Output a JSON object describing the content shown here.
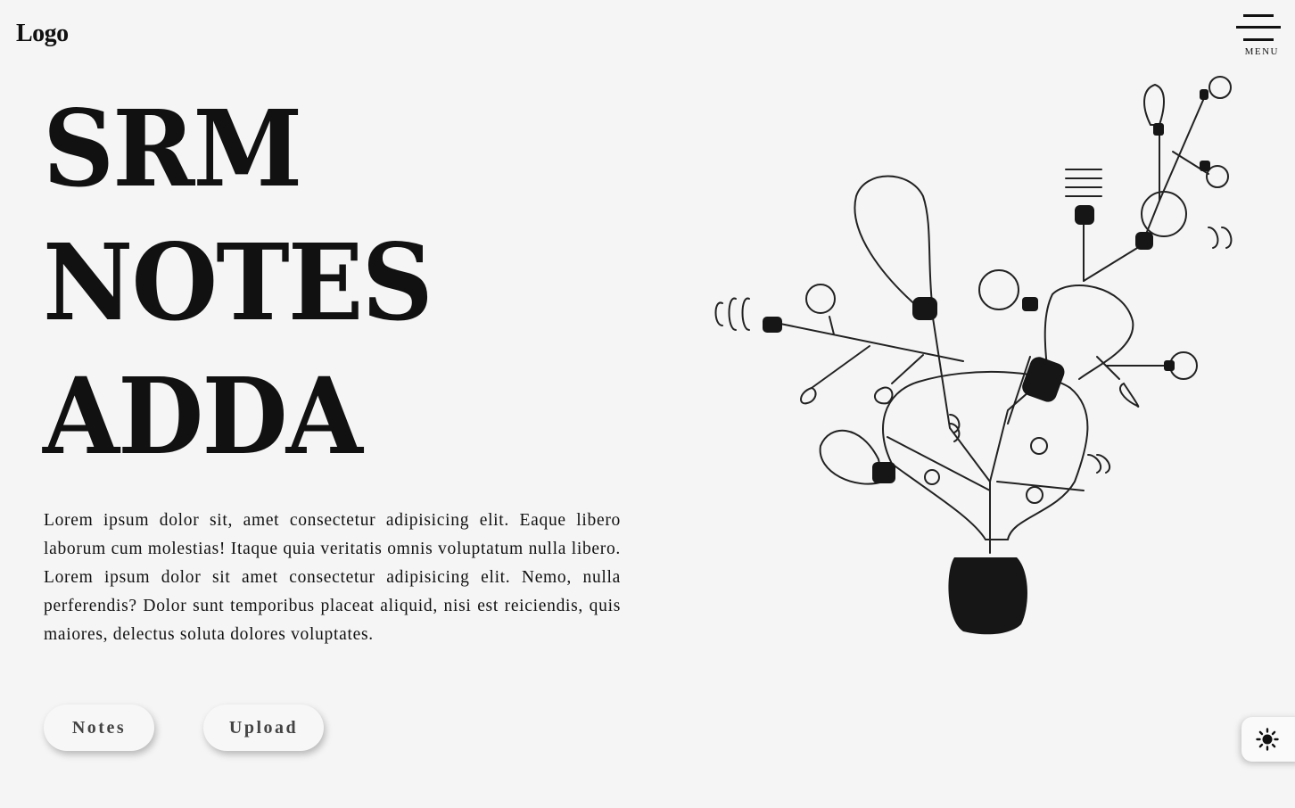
{
  "header": {
    "logo": "Logo",
    "menu_label": "MENU"
  },
  "hero": {
    "lines": [
      "SRM",
      "NOTES",
      "ADDA"
    ]
  },
  "description": "Lorem ipsum dolor sit, amet consectetur adipisicing elit. Eaque libero laborum cum molestias! Itaque quia veritatis omnis voluptatum nulla libero. Lorem ipsum dolor sit amet consectetur adipisicing elit. Nemo, nulla perferendis? Dolor sunt temporibus placeat aliquid, nisi est reiciendis, quis maiores, delectus soluta dolores voluptates.",
  "buttons": {
    "notes": "Notes",
    "upload": "Upload"
  },
  "icons": {
    "menu": "hamburger-icon",
    "theme": "sun-icon",
    "illustration": "lightbulb-tree-illustration"
  }
}
